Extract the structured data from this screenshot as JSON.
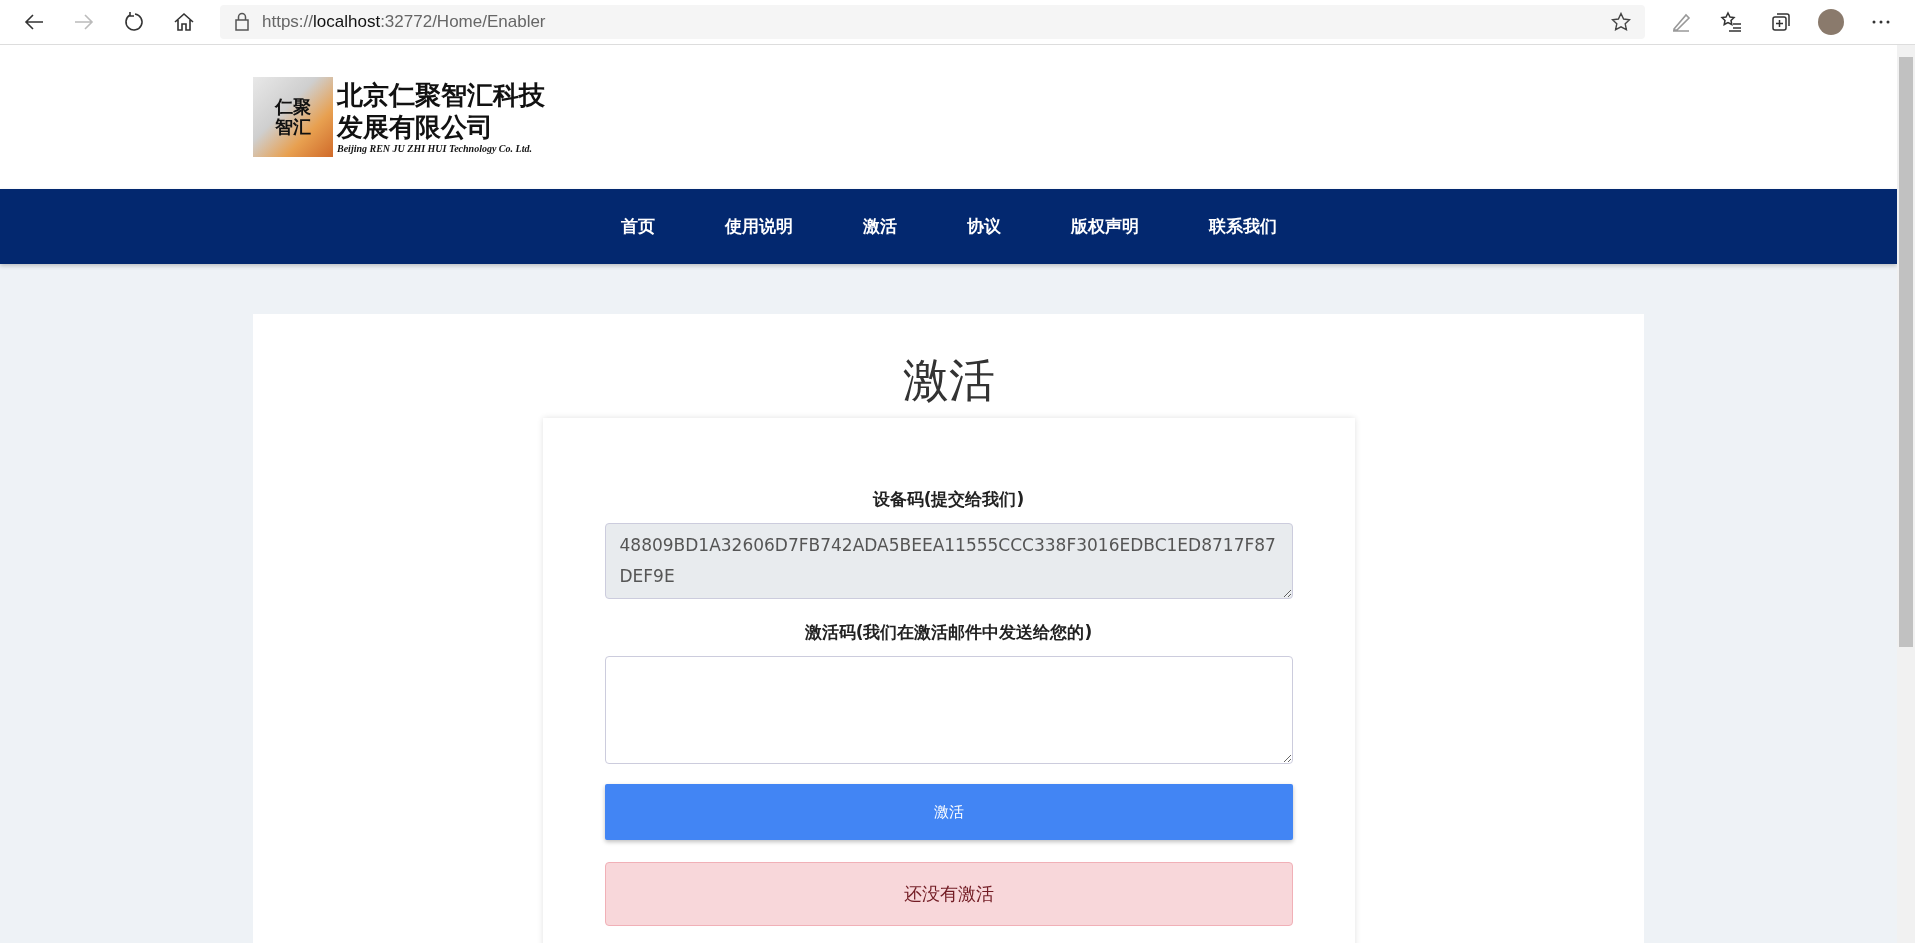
{
  "browser": {
    "url": {
      "scheme": "https://",
      "host": "localhost",
      "path": ":32772/Home/Enabler"
    }
  },
  "header": {
    "logo": {
      "mark": [
        "仁聚",
        "智汇"
      ],
      "name_lines": [
        "北京仁聚智汇科技",
        "发展有限公司"
      ],
      "english": "Beijing REN JU ZHI HUI Technology Co. Ltd."
    }
  },
  "nav": {
    "items": [
      {
        "label": "首页",
        "selected": false
      },
      {
        "label": "使用说明",
        "selected": false
      },
      {
        "label": "激活",
        "selected": false
      },
      {
        "label": "协议",
        "selected": false
      },
      {
        "label": "版权声明",
        "selected": false
      },
      {
        "label": "联系我们",
        "selected": false
      }
    ]
  },
  "page": {
    "title": "激活",
    "form": {
      "device_code": {
        "label": "设备码(提交给我们)",
        "value": "48809BD1A32606D7FB742ADA5BEEA11555CCC338F3016EDBC1ED8717F87DEF9E",
        "disabled": true
      },
      "activation_code": {
        "label": "激活码(我们在激活邮件中发送给您的)",
        "disabled": false
      },
      "button": "激活",
      "status": {
        "text": "还没有激活",
        "kind": "danger"
      }
    }
  }
}
